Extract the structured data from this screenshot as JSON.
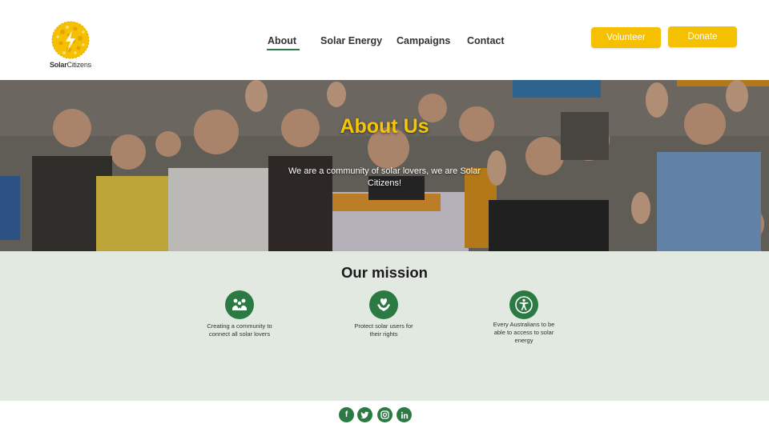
{
  "brand": {
    "name_bold": "Solar",
    "name_regular": "Citizens",
    "accent": "#f5c000",
    "green": "#2c7a43"
  },
  "nav": {
    "items": [
      {
        "label": "About",
        "active": true
      },
      {
        "label": "Solar Energy"
      },
      {
        "label": "Campaigns"
      },
      {
        "label": "Contact"
      }
    ]
  },
  "actions": {
    "volunteer_label": "Volunteer",
    "donate_label": "Donate"
  },
  "hero": {
    "title": "About Us",
    "subtitle": "We are a community of solar lovers, we are Solar Citizens!"
  },
  "mission": {
    "title": "Our mission",
    "items": [
      {
        "icon": "community-icon",
        "text": "Creating a community to connect all solar lovers"
      },
      {
        "icon": "heart-hands-icon",
        "text": "Protect solar users for their rights"
      },
      {
        "icon": "accessibility-icon",
        "text": "Every Australians to be able to access to solar energy"
      }
    ]
  },
  "footer": {
    "social": [
      "facebook-icon",
      "twitter-icon",
      "instagram-icon",
      "linkedin-icon"
    ]
  }
}
